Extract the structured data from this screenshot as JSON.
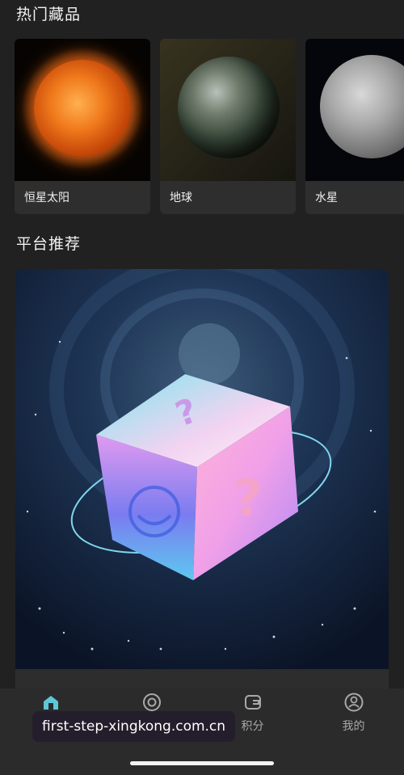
{
  "hot_collection": {
    "title": "热门藏品",
    "items": [
      {
        "label": "恒星太阳"
      },
      {
        "label": "地球"
      },
      {
        "label": "水星"
      }
    ]
  },
  "recommended": {
    "title": "平台推荐"
  },
  "bottom_nav": {
    "items": [
      {
        "label": "",
        "icon": "home-icon",
        "active": true
      },
      {
        "label": "",
        "icon": "discover-icon",
        "active": false
      },
      {
        "label": "积分",
        "icon": "wallet-icon",
        "active": false
      },
      {
        "label": "我的",
        "icon": "profile-icon",
        "active": false
      }
    ]
  },
  "watermark": "first-step-xingkong.com.cn",
  "colors": {
    "background": "#212121",
    "card": "#2e2e2e",
    "nav_bg": "#2b2b2b",
    "accent": "#5ec8d8"
  }
}
